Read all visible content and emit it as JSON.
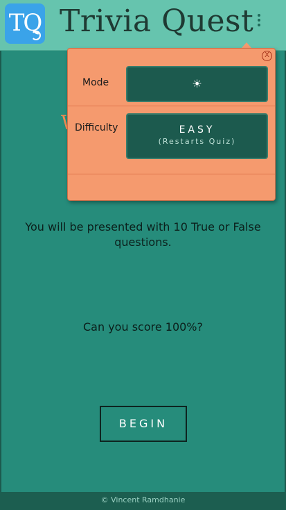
{
  "header": {
    "logo_text": "TQ",
    "title": "Trivia Quest",
    "menu_icon": "more-vert-icon"
  },
  "main": {
    "partial_heading": "W",
    "intro_text": "You will be presented with 10 True or False questions.",
    "question_text": "Can you score 100%?",
    "begin_label": "BEGIN"
  },
  "menu": {
    "close_label": "X",
    "mode_label": "Mode",
    "mode_icon": "sun-icon",
    "mode_glyph": "☀",
    "difficulty_label": "Difficulty",
    "difficulty_value": "EASY",
    "difficulty_note": "(Restarts Quiz)"
  },
  "footer": {
    "text": "© Vincent Ramdhanie"
  },
  "colors": {
    "background": "#268c7b",
    "header": "#66c4ae",
    "menu": "#f59a6e",
    "button": "#1c5a4e",
    "accent_text": "#f08a52"
  }
}
